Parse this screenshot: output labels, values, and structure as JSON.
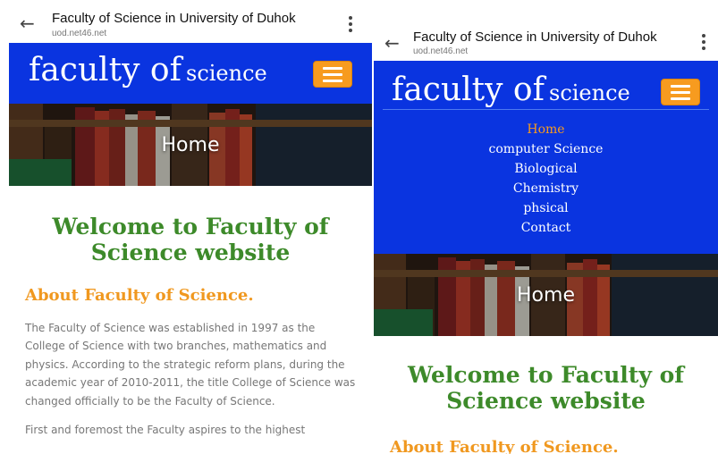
{
  "left": {
    "browser": {
      "title": "Faculty of Science in University of Duhok",
      "url": "uod.net46.net",
      "back_icon": "←"
    },
    "site": {
      "brand_big": "faculty of",
      "brand_small": "science"
    },
    "hero": {
      "title": "Home"
    },
    "content": {
      "welcome": "Welcome to Faculty of Science website",
      "about_heading": "About Faculty of Science.",
      "paragraph1": "The Faculty of Science was established in 1997 as the College of Science with two branches, mathematics and physics. According to the strategic reform plans, during the academic year of 2010-2011, the title College of Science was changed officially to be the Faculty of Science.",
      "paragraph2": "First and foremost the Faculty aspires to the highest"
    }
  },
  "right": {
    "browser": {
      "title": "Faculty of Science in University of Duhok",
      "url": "uod.net46.net",
      "back_icon": "←"
    },
    "site": {
      "brand_big": "faculty of",
      "brand_small": "science"
    },
    "nav": [
      {
        "label": "Home"
      },
      {
        "label": "computer Science"
      },
      {
        "label": "Biological"
      },
      {
        "label": "Chemistry"
      },
      {
        "label": "phsical"
      },
      {
        "label": "Contact"
      }
    ],
    "hero": {
      "title": "Home"
    },
    "content": {
      "welcome": "Welcome to Faculty of Science website",
      "about_heading": "About Faculty of Science."
    }
  },
  "colors": {
    "header_blue": "#0a34e0",
    "menu_orange": "#f79b1f",
    "welcome_green": "#3d8a2a",
    "about_orange": "#f0981f"
  },
  "icons": {
    "back": "back-arrow-icon",
    "menu": "hamburger-menu-icon",
    "more": "kebab-menu-icon"
  }
}
